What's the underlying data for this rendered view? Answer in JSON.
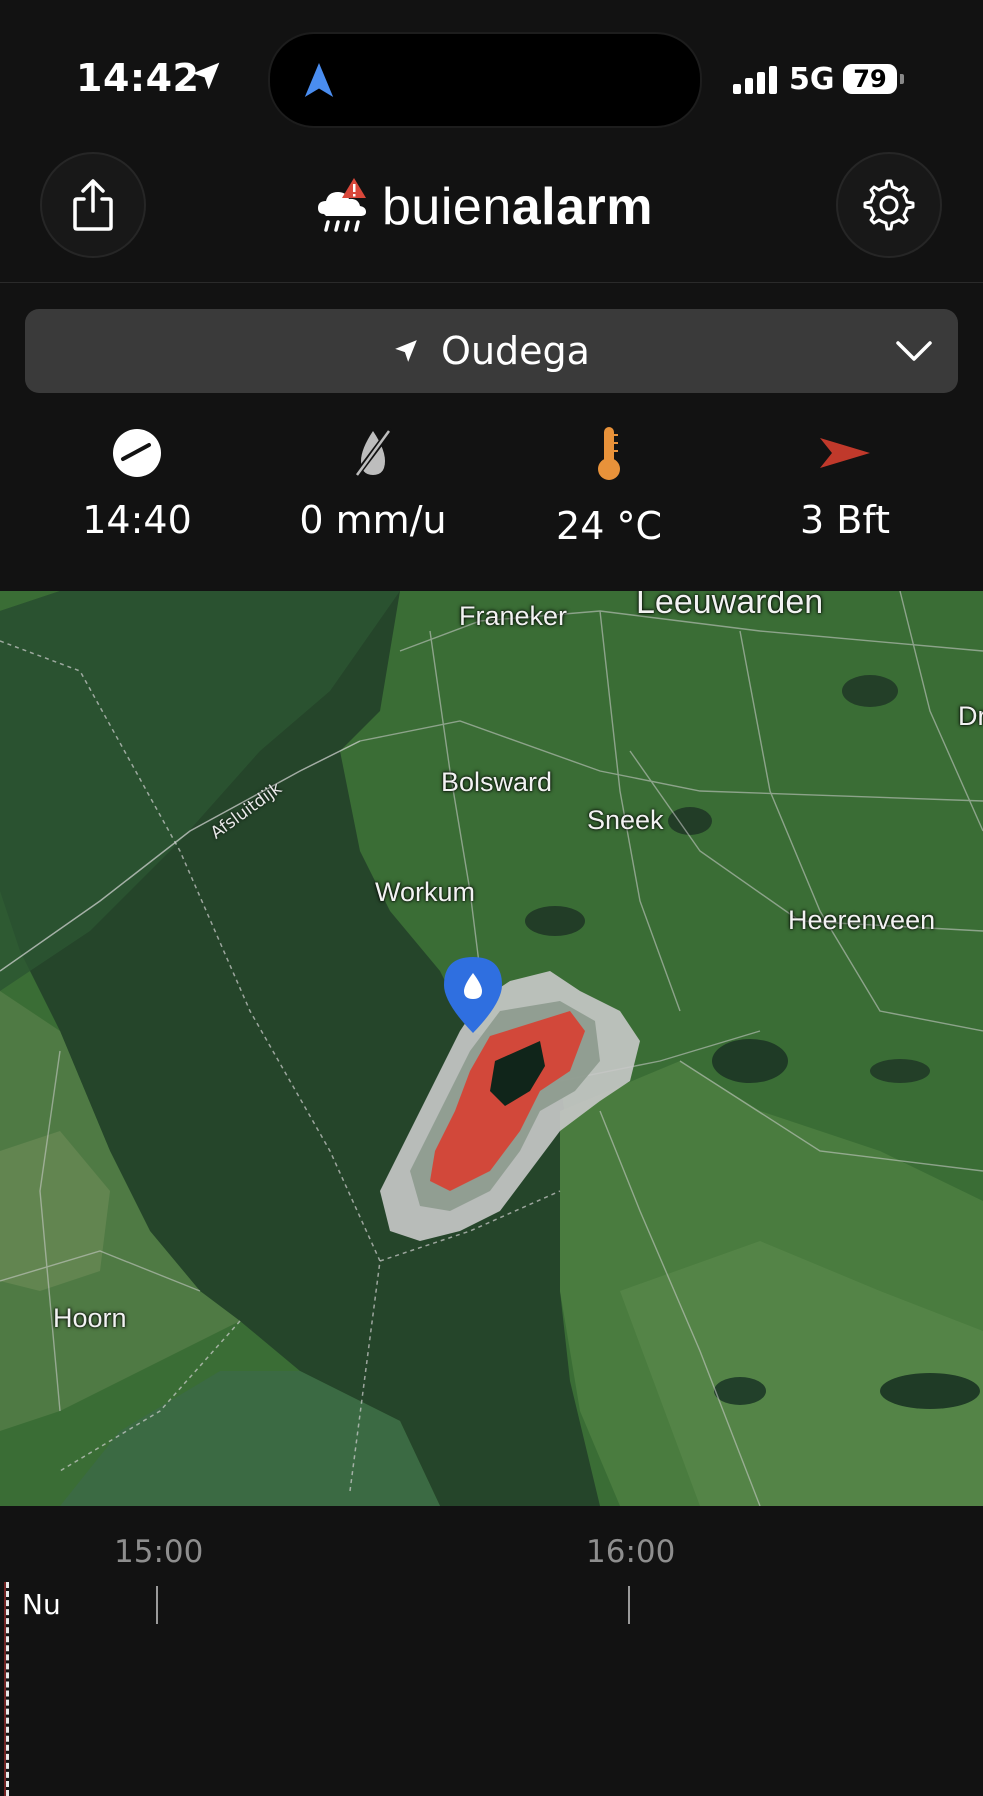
{
  "status_bar": {
    "time": "14:42",
    "network": "5G",
    "battery": "79"
  },
  "header": {
    "logo_light": "buien",
    "logo_bold": "alarm"
  },
  "location": {
    "name": "Oudega"
  },
  "stats": [
    {
      "icon": "clock-icon",
      "value": "14:40"
    },
    {
      "icon": "rain-drop-off-icon",
      "value": "0 mm/u"
    },
    {
      "icon": "thermometer-icon",
      "value": "24 °C"
    },
    {
      "icon": "wind-direction-icon",
      "value": "3 Bft"
    }
  ],
  "map": {
    "places": [
      "Franeker",
      "Leeuwarden",
      "Bolsward",
      "Sneek",
      "Workum",
      "Heerenveen",
      "Hoorn",
      "Dr"
    ],
    "road_label": "Afsluitdijk",
    "pin_icon": "rain-drop-location-pin-icon"
  },
  "timeline": {
    "now_label": "Nu",
    "ticks": [
      "15:00",
      "16:00"
    ]
  },
  "colors": {
    "accent_blue": "#2f6fe0",
    "thermometer": "#e8923a",
    "wind_arrow": "#c0392b",
    "background": "#121212"
  }
}
